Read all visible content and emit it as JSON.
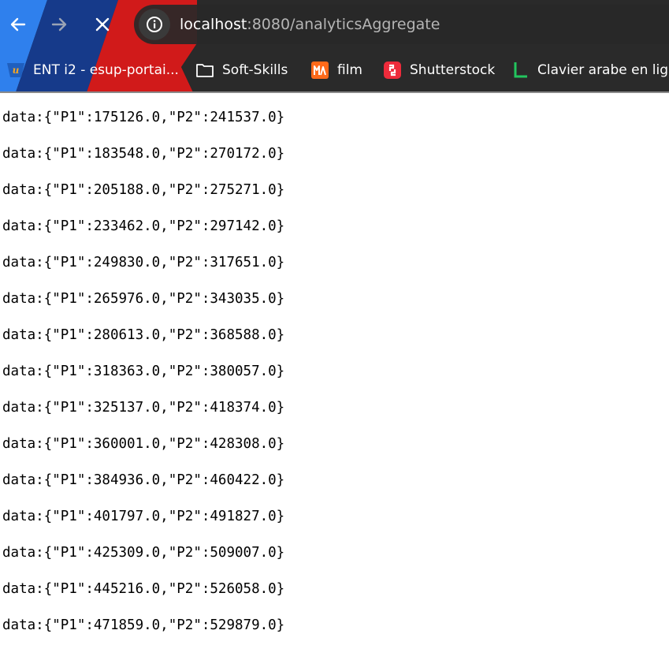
{
  "browser": {
    "url_host": "localhost",
    "url_rest": ":8080/analyticsAggregate",
    "nav_icons": [
      "back-arrow-icon",
      "forward-arrow-icon",
      "close-icon",
      "info-icon"
    ]
  },
  "bookmarks": [
    {
      "label": "ENT i2 - esup-portai...",
      "icon": "ent-logo-icon",
      "color": "#1f5fbf"
    },
    {
      "label": "Soft-Skills",
      "icon": "folder-icon",
      "color": "#ffffff"
    },
    {
      "label": "film",
      "icon": "film-logo-icon",
      "color": "#ff6a1a"
    },
    {
      "label": "Shutterstock",
      "icon": "shutterstock-logo-icon",
      "color": "#ee2b3b"
    },
    {
      "label": "Clavier arabe en lig...",
      "icon": "clavier-logo-icon",
      "color": "#22c55e"
    }
  ],
  "data_lines": [
    "data:{\"P1\":175126.0,\"P2\":241537.0}",
    "data:{\"P1\":183548.0,\"P2\":270172.0}",
    "data:{\"P1\":205188.0,\"P2\":275271.0}",
    "data:{\"P1\":233462.0,\"P2\":297142.0}",
    "data:{\"P1\":249830.0,\"P2\":317651.0}",
    "data:{\"P1\":265976.0,\"P2\":343035.0}",
    "data:{\"P1\":280613.0,\"P2\":368588.0}",
    "data:{\"P1\":318363.0,\"P2\":380057.0}",
    "data:{\"P1\":325137.0,\"P2\":418374.0}",
    "data:{\"P1\":360001.0,\"P2\":428308.0}",
    "data:{\"P1\":384936.0,\"P2\":460422.0}",
    "data:{\"P1\":401797.0,\"P2\":491827.0}",
    "data:{\"P1\":425309.0,\"P2\":509007.0}",
    "data:{\"P1\":445216.0,\"P2\":526058.0}",
    "data:{\"P1\":471859.0,\"P2\":529879.0}"
  ]
}
